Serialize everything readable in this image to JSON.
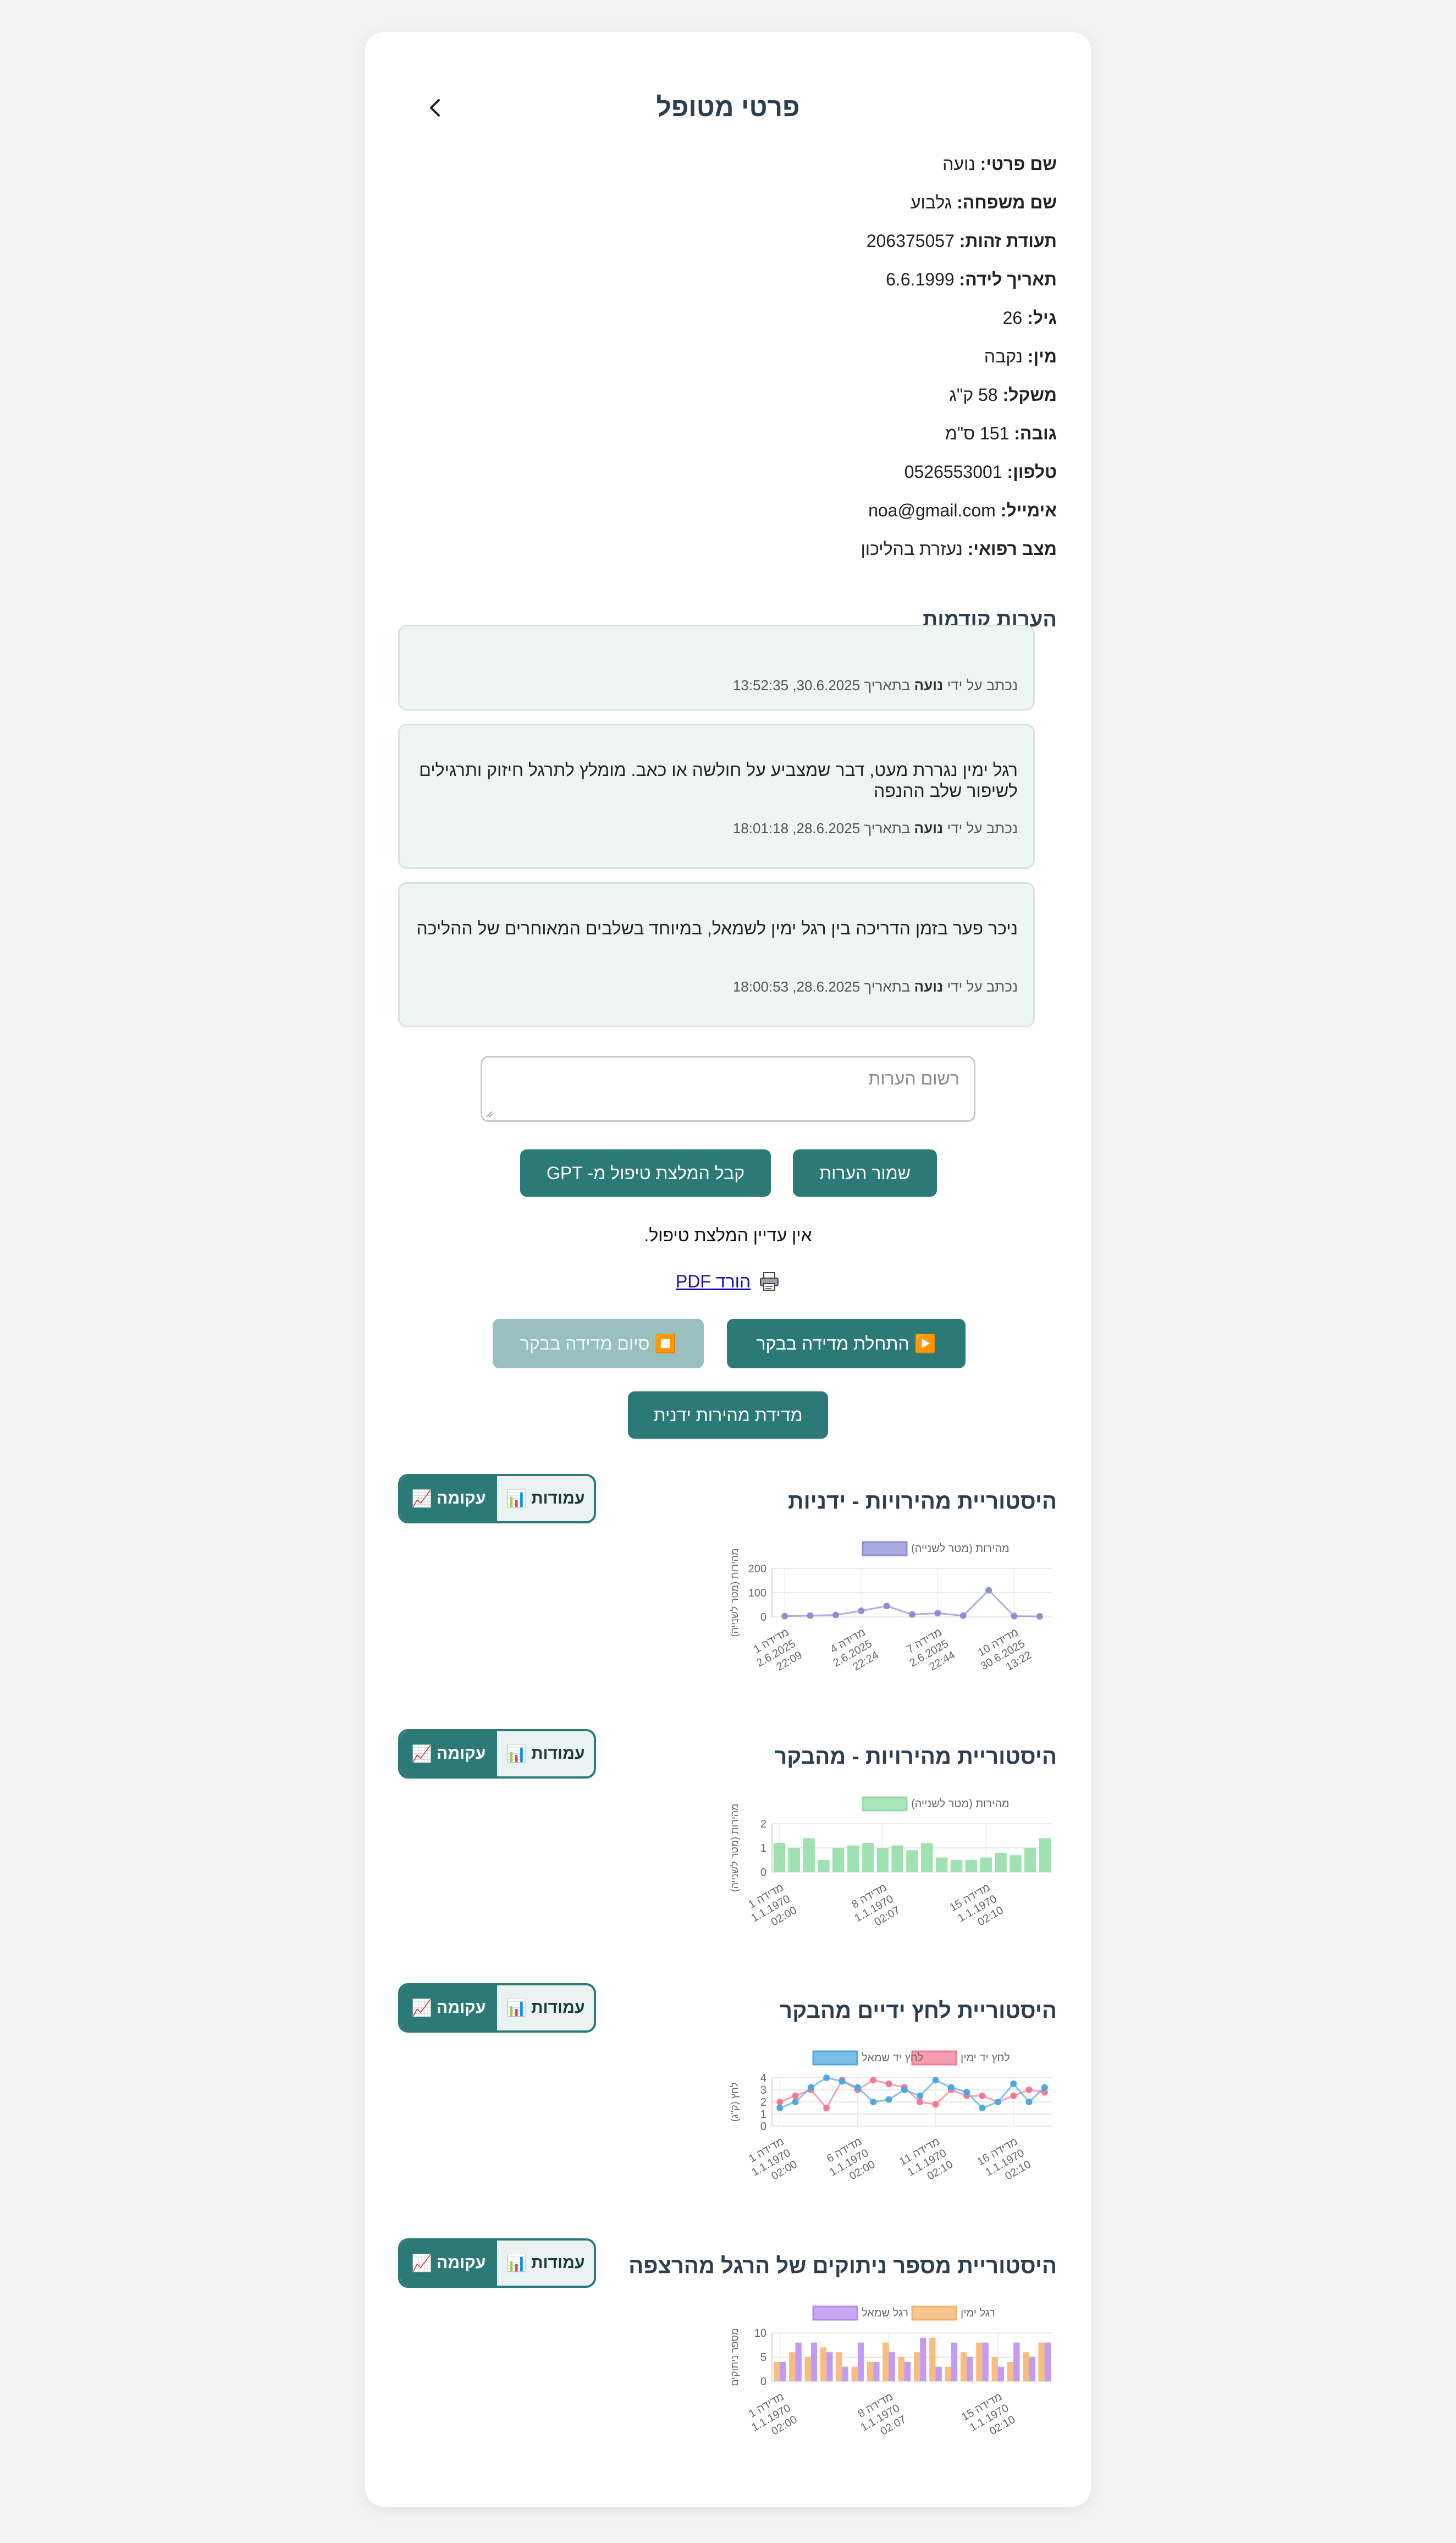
{
  "header": {
    "title": "פרטי מטופל",
    "back_icon": "chevron-left-icon"
  },
  "patient": [
    {
      "label": "שם פרטי:",
      "value": "נועה"
    },
    {
      "label": "שם משפחה:",
      "value": "גלבוע"
    },
    {
      "label": "תעודת זהות:",
      "value": "206375057"
    },
    {
      "label": "תאריך לידה:",
      "value": "6.6.1999"
    },
    {
      "label": "גיל:",
      "value": "26"
    },
    {
      "label": "מין:",
      "value": "נקבה"
    },
    {
      "label": "משקל:",
      "value": "58 ק\"ג"
    },
    {
      "label": "גובה:",
      "value": "151 ס\"מ"
    },
    {
      "label": "טלפון:",
      "value": "0526553001"
    },
    {
      "label": "אימייל:",
      "value": "noa@gmail.com"
    },
    {
      "label": "מצב רפואי:",
      "value": "נעזרת בהליכון"
    }
  ],
  "notes_section": {
    "title": "הערות קודמות",
    "notes": [
      {
        "text": "",
        "meta_prefix": "נכתב על ידי",
        "author": "נועה",
        "meta_suffix": "בתאריך 30.6.2025, 13:52:35"
      },
      {
        "text": "רגל ימין נגררת מעט, דבר שמצביע על חולשה או כאב. מומלץ לתרגל חיזוק ותרגילים לשיפור שלב ההנפה",
        "meta_prefix": "נכתב על ידי",
        "author": "נועה",
        "meta_suffix": "בתאריך 28.6.2025, 18:01:18"
      },
      {
        "text": "ניכר פער בזמן הדריכה בין רגל ימין לשמאל, במיוחד בשלבים המאוחרים של ההליכה",
        "meta_prefix": "נכתב על ידי",
        "author": "נועה",
        "meta_suffix": "בתאריך 28.6.2025, 18:00:53"
      }
    ],
    "input_placeholder": "רשום הערות"
  },
  "actions": {
    "save_notes": "שמור הערות",
    "get_gpt": "קבל המלצת טיפול מ- GPT",
    "no_recommendation": "אין עדיין המלצת טיפול.",
    "download_pdf": "הורד PDF",
    "pdf_icon": "printer-icon",
    "start_measure": "▶️ התחלת מדידה בבקר",
    "stop_measure": "⏹️ סיום מדידה בבקר",
    "manual_speed": "מדידת מהירות ידנית"
  },
  "toggle": {
    "bars": "עמודות",
    "bars_icon": "📊",
    "curve": "עקומה",
    "curve_icon": "📈"
  },
  "charts_titles": [
    "היסטוריית מהירויות - ידניות",
    "היסטוריית מהירויות - מהבקר",
    "היסטוריית לחץ ידיים מהבקר",
    "היסטוריית מספר ניתוקים של הרגל מהרצפה"
  ],
  "chart_data": [
    {
      "type": "line",
      "legend": [
        "מהירות (מטר לשנייה)"
      ],
      "ylabel": "מהירות (מטר לשנייה)",
      "ylim": [
        0,
        200
      ],
      "yticks": [
        0,
        100,
        200
      ],
      "xtick_labels": [
        [
          "מדידה 1",
          "2.6.2025",
          "22:09"
        ],
        [
          "מדידה 4",
          "2.6.2025",
          "22:24"
        ],
        [
          "מדידה 7",
          "2.6.2025",
          "22:44"
        ],
        [
          "מדידה 10",
          "30.6.2025",
          "13:22"
        ]
      ],
      "xtick_index": [
        0,
        3,
        6,
        9
      ],
      "series": [
        {
          "name": "מהירות (מטר לשנייה)",
          "color": "#8c8fd6",
          "values": [
            3,
            5,
            8,
            25,
            45,
            10,
            15,
            5,
            110,
            3,
            2
          ]
        }
      ]
    },
    {
      "type": "bar",
      "legend": [
        "מהירות (מטר לשנייה)"
      ],
      "ylabel": "מהירות (מטר לשנייה)",
      "ylim": [
        0,
        2
      ],
      "yticks": [
        0,
        1,
        2
      ],
      "xtick_labels": [
        [
          "מדידה 1",
          "1.1.1970",
          "02:00"
        ],
        [
          "מדידה 8",
          "1.1.1970",
          "02:07"
        ],
        [
          "מדידה 15",
          "1.1.1970",
          "02:10"
        ]
      ],
      "xtick_index": [
        0,
        7,
        14
      ],
      "series": [
        {
          "name": "מהירות (מטר לשנייה)",
          "color": "#8fdca4",
          "values": [
            1.2,
            1.0,
            1.4,
            0.5,
            1.0,
            1.1,
            1.2,
            1.0,
            1.1,
            0.9,
            1.2,
            0.6,
            0.5,
            0.5,
            0.6,
            0.8,
            0.7,
            1.0,
            1.4
          ]
        }
      ]
    },
    {
      "type": "line",
      "legend": [
        "לחץ יד ימין",
        "לחץ יד שמאל"
      ],
      "ylabel": "לחץ (ק\"ג)",
      "ylim": [
        0,
        4
      ],
      "yticks": [
        0,
        1,
        2,
        3,
        4
      ],
      "xtick_labels": [
        [
          "מדידה 1",
          "1.1.1970",
          "02:00"
        ],
        [
          "מדידה 6",
          "1.1.1970",
          "02:00"
        ],
        [
          "מדידה 11",
          "1.1.1970",
          "02:10"
        ],
        [
          "מדידה 16",
          "1.1.1970",
          "02:10"
        ]
      ],
      "xtick_index": [
        0,
        5,
        10,
        15
      ],
      "series": [
        {
          "name": "לחץ יד ימין",
          "color": "#f47a93",
          "values": [
            2.0,
            2.5,
            3.0,
            1.5,
            3.8,
            3.0,
            3.8,
            3.5,
            3.2,
            2.0,
            1.8,
            3.0,
            2.5,
            2.5,
            2.0,
            2.5,
            3.0,
            2.8
          ]
        },
        {
          "name": "לחץ יד שמאל",
          "color": "#4ea8e0",
          "values": [
            1.5,
            2.0,
            3.2,
            4.0,
            3.7,
            3.2,
            2.0,
            2.2,
            3.0,
            2.5,
            3.8,
            3.2,
            2.8,
            1.5,
            2.0,
            3.5,
            2.0,
            3.2
          ]
        }
      ]
    },
    {
      "type": "bar",
      "legend": [
        "רגל ימין",
        "רגל שמאל"
      ],
      "ylabel": "מספר ניתוקים",
      "ylim": [
        0,
        10
      ],
      "yticks": [
        0,
        5,
        10
      ],
      "xtick_labels": [
        [
          "מדידה 1",
          "1.1.1970",
          "02:00"
        ],
        [
          "מדידה 8",
          "1.1.1970",
          "02:07"
        ],
        [
          "מדידה 15",
          "1.1.1970",
          "02:10"
        ]
      ],
      "xtick_index": [
        0,
        7,
        14
      ],
      "series": [
        {
          "name": "רגל ימין",
          "color": "#f6b26b",
          "values": [
            4,
            6,
            5,
            7,
            6,
            3,
            4,
            8,
            5,
            6,
            9,
            3,
            6,
            8,
            5,
            4,
            6,
            8
          ]
        },
        {
          "name": "רגל שמאל",
          "color": "#b78af0",
          "values": [
            4,
            8,
            8,
            6,
            3,
            8,
            4,
            6,
            4,
            9,
            3,
            8,
            5,
            8,
            3,
            8,
            5,
            8
          ]
        }
      ]
    }
  ]
}
